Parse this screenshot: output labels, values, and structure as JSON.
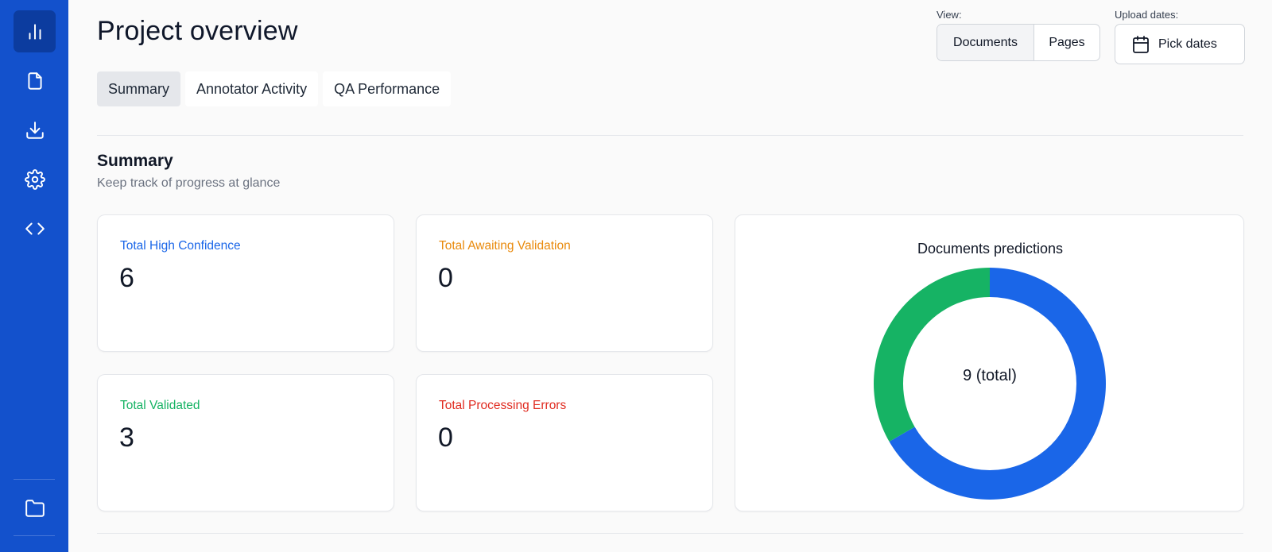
{
  "sidebar": {
    "items": [
      {
        "icon": "bar-chart-icon",
        "active": true
      },
      {
        "icon": "file-icon"
      },
      {
        "icon": "download-icon"
      },
      {
        "icon": "gear-icon"
      },
      {
        "icon": "code-icon"
      }
    ],
    "bottom_item": {
      "icon": "folder-icon"
    }
  },
  "header": {
    "title": "Project overview",
    "view_label": "View:",
    "view_options": [
      "Documents",
      "Pages"
    ],
    "view_selected": "Documents",
    "upload_label": "Upload dates:",
    "pick_dates_label": "Pick dates"
  },
  "tabs": [
    {
      "label": "Summary",
      "active": true
    },
    {
      "label": "Annotator Activity"
    },
    {
      "label": "QA Performance"
    }
  ],
  "summary": {
    "title": "Summary",
    "subtitle": "Keep track of progress at glance",
    "cards": [
      {
        "label": "Total High Confidence",
        "value": "6",
        "color": "#1a66e8"
      },
      {
        "label": "Total Awaiting Validation",
        "value": "0",
        "color": "#e98a0c"
      },
      {
        "label": "Total Validated",
        "value": "3",
        "color": "#16b364"
      },
      {
        "label": "Total Processing Errors",
        "value": "0",
        "color": "#e02b20"
      }
    ]
  },
  "chart_data": {
    "type": "pie",
    "title": "Documents predictions",
    "center_label": "9 (total)",
    "slices": [
      {
        "value": 6,
        "color": "#1a66e8"
      },
      {
        "value": 3,
        "color": "#16b364"
      }
    ]
  }
}
